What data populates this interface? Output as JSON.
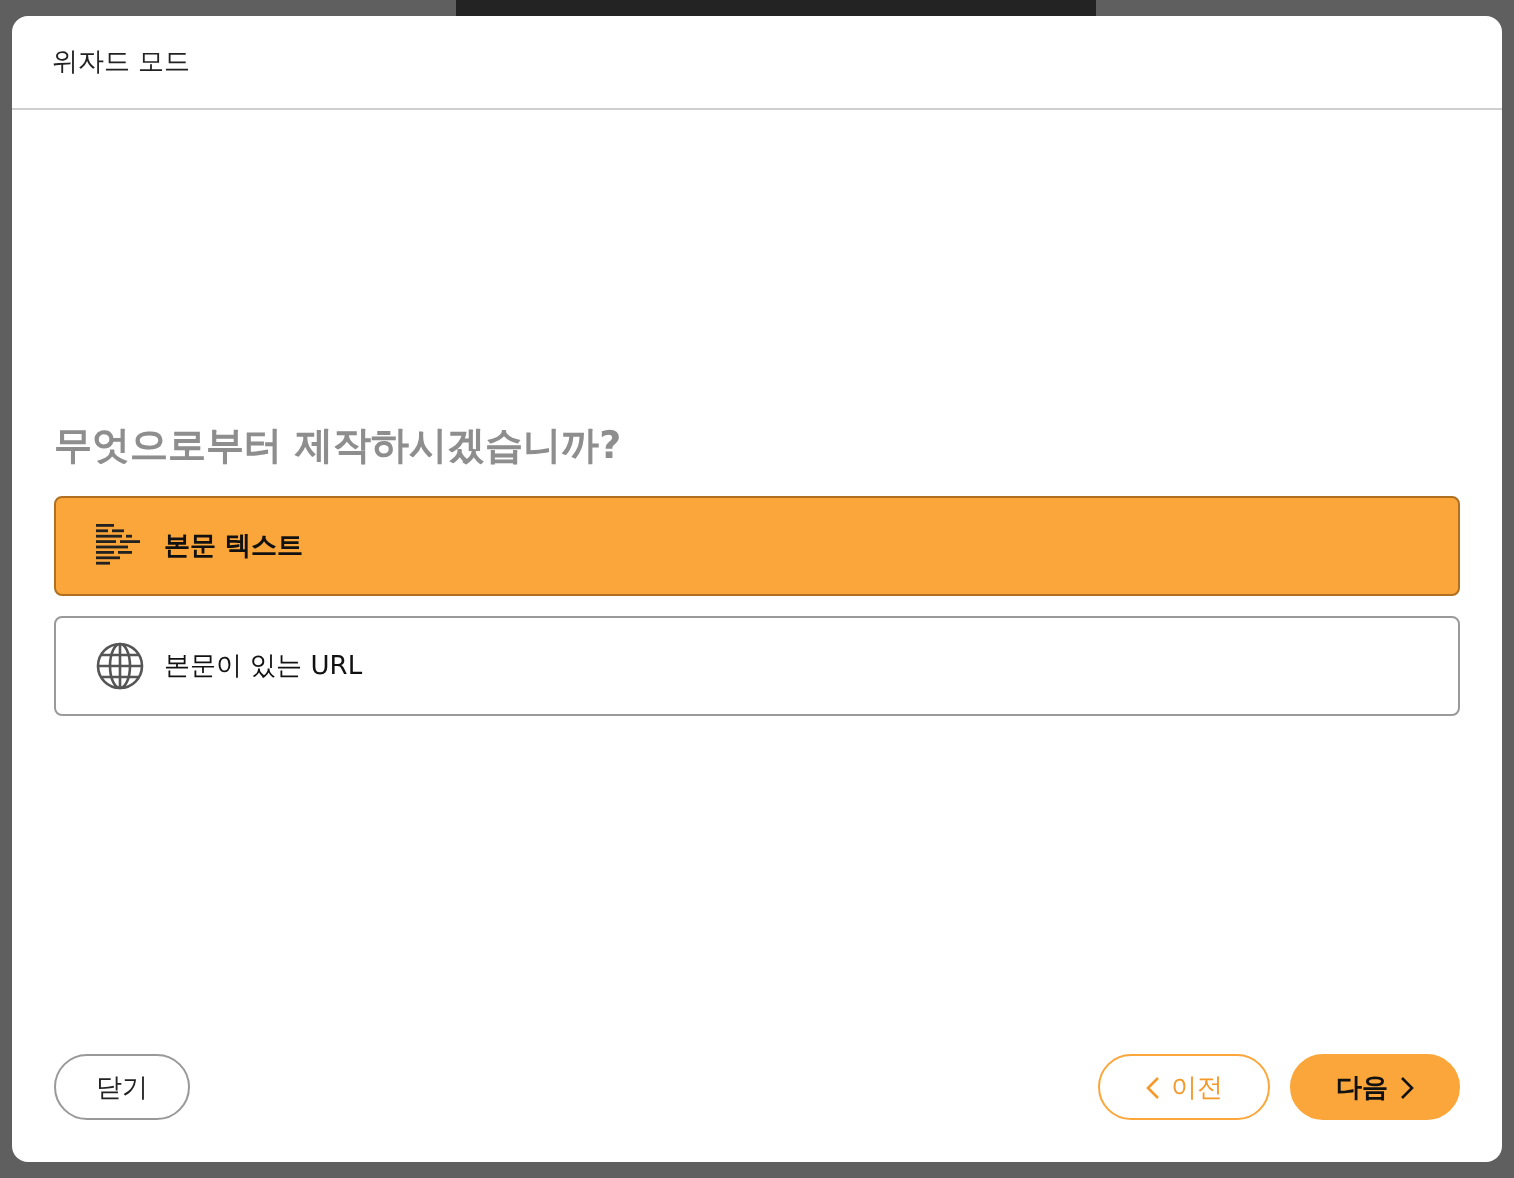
{
  "window": {
    "title": "위자드 모드"
  },
  "question": "무엇으로부터 제작하시겠습니까?",
  "options": [
    {
      "label": "본문 텍스트",
      "kind": "text",
      "selected": true
    },
    {
      "label": "본문이 있는 URL",
      "kind": "url",
      "selected": false
    }
  ],
  "buttons": [
    {
      "label": "닫기",
      "kind": "close"
    },
    {
      "label": "이전",
      "kind": "prev"
    },
    {
      "label": "다음",
      "kind": "next"
    }
  ]
}
